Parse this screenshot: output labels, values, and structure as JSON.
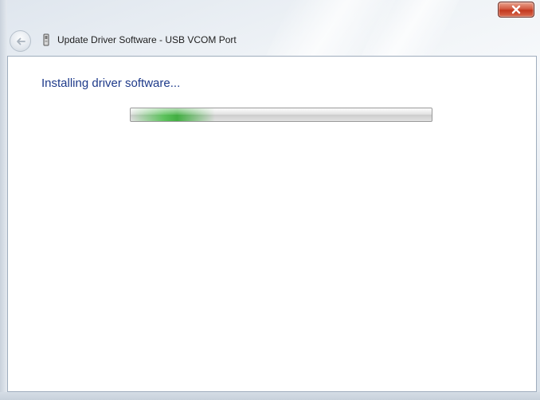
{
  "window": {
    "title": "Update Driver Software - USB VCOM Port",
    "icons": {
      "back": "back-arrow-icon",
      "device": "usb-device-icon",
      "close": "close-icon"
    },
    "colors": {
      "close_button": "#c2381f",
      "heading": "#1e3a8a",
      "progress_fill": "#3cb43c"
    }
  },
  "content": {
    "heading": "Installing driver software...",
    "progress": {
      "fraction": 0.28,
      "indeterminate": true
    }
  }
}
